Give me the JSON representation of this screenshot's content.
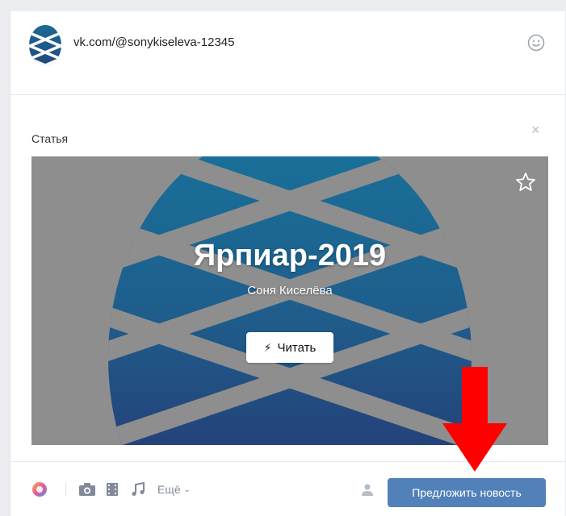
{
  "composer": {
    "link_text": "vk.com/@sonykiseleva-12345",
    "avatar_icon": "pinecone-logo-icon",
    "emoji_icon": "smile-icon"
  },
  "attachment": {
    "title": "Статья",
    "remove_icon": "close-icon",
    "article": {
      "title": "Ярпиар-2019",
      "author": "Соня Киселёва",
      "read_label": "Читать",
      "read_icon": "lightning-bolt-icon",
      "bookmark_icon": "star-icon"
    }
  },
  "toolbar": {
    "more_label": "Ещё",
    "suggest_label": "Предложить новость",
    "icons": [
      "color-palette-icon",
      "camera-icon",
      "video-icon",
      "music-icon",
      "user-icon"
    ]
  },
  "annotation": {
    "arrow_color": "#ff0000"
  },
  "colors": {
    "accent": "#5181b8",
    "article_bg": "#8e8e8e",
    "pinecone_top": "#1a6f98",
    "pinecone_bottom": "#23467e"
  }
}
